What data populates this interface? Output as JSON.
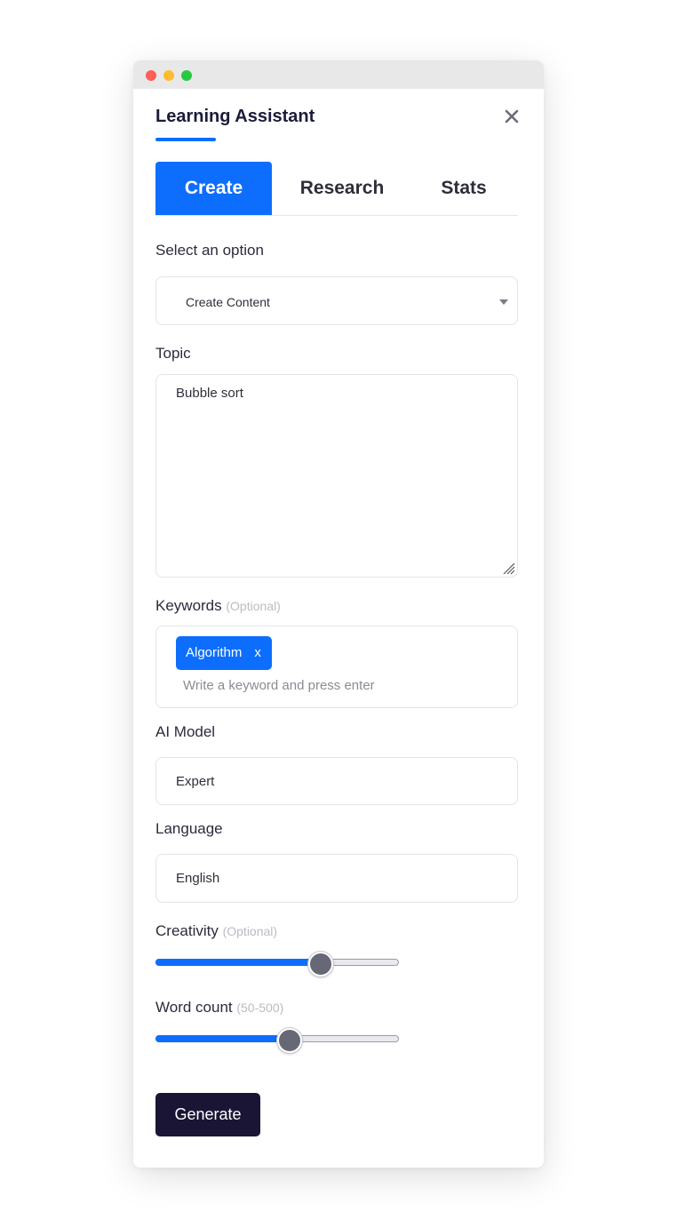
{
  "window": {
    "title": "Learning Assistant"
  },
  "tabs": [
    {
      "label": "Create",
      "active": true
    },
    {
      "label": "Research",
      "active": false
    },
    {
      "label": "Stats",
      "active": false
    }
  ],
  "option": {
    "label": "Select an option",
    "value": "Create Content"
  },
  "topic": {
    "label": "Topic",
    "value": "Bubble sort"
  },
  "keywords": {
    "label": "Keywords",
    "hint": "(Optional)",
    "chips": [
      "Algorithm"
    ],
    "chip_remove": "x",
    "placeholder": "Write a keyword and press enter"
  },
  "ai_model": {
    "label": "AI Model",
    "value": "Expert"
  },
  "language": {
    "label": "Language",
    "value": "English"
  },
  "creativity": {
    "label": "Creativity",
    "hint": "(Optional)",
    "level_fraction": 0.68
  },
  "word_count": {
    "label": "Word count",
    "hint": "(50-500)",
    "level_fraction": 0.55
  },
  "generate_label": "Generate",
  "colors": {
    "accent": "#0d6efd",
    "button_dark": "#1a1535",
    "title": "#1b1b3a"
  },
  "icons": {
    "close": "close-icon",
    "dropdown": "chevron-down-icon",
    "resize": "resize-grip-icon"
  }
}
